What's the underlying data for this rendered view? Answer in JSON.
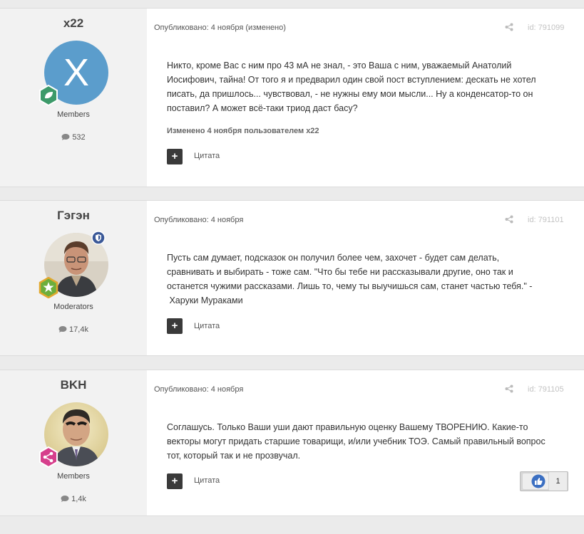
{
  "posts": [
    {
      "username": "x22",
      "avatar_letter": "X",
      "avatar_color": "#5b9dcc",
      "group": "Members",
      "post_count": "532",
      "published": "Опубликовано: 4 ноября (изменено)",
      "post_id": "id: 791099",
      "content_lines": [
        "Никто, кроме Вас с ним про 43 мА не знал, - это Ваша с ним, уважаемый Анатолий",
        "Иосифович, тайна! От того я и предварил один свой пост вступлением: дескать не хотел",
        "писать, да пришлось... чувствовал, - не нужны ему мои мысли... Ну а конденсатор-то он",
        "поставил? А может всё-таки триод даст басу?"
      ],
      "edited_note": "Изменено 4 ноября пользователем x22",
      "quote_label": "Цитата",
      "rank_badge_color": "#3d9a6a"
    },
    {
      "username": "Гэгэн",
      "group": "Moderators",
      "post_count": "17,4k",
      "published": "Опубликовано: 4 ноября",
      "post_id": "id: 791101",
      "content_lines": [
        "Пусть сам думает,  подсказок он получил более чем, захочет - будет сам делать,",
        "сравнивать и выбирать - тоже сам.  \"Что бы тебе ни рассказывали другие, оно так и",
        "останется чужими рассказами.  Лишь то, чему ты выучишься сам, станет частью тебя.\" -",
        " Харуки Мураками"
      ],
      "quote_label": "Цитата",
      "rank_badge_color": "#6cae3c",
      "group_badge_color": "#3b5998"
    },
    {
      "username": "BKH",
      "group": "Members",
      "post_count": "1,4k",
      "published": "Опубликовано: 4 ноября",
      "post_id": "id: 791105",
      "content_lines": [
        "Соглашусь. Только Ваши уши  дают правильную оценку Вашему ТВОРЕНИЮ.  Какие-то",
        "векторы могут придать старшие товарищи, и/или учебник ТОЭ.  Самый правильный вопрос",
        "тот, который так и не прозвучал."
      ],
      "quote_label": "Цитата",
      "reaction_count": "1",
      "rank_badge_color": "#d63f8c",
      "like_color": "#3b6fc2"
    }
  ]
}
